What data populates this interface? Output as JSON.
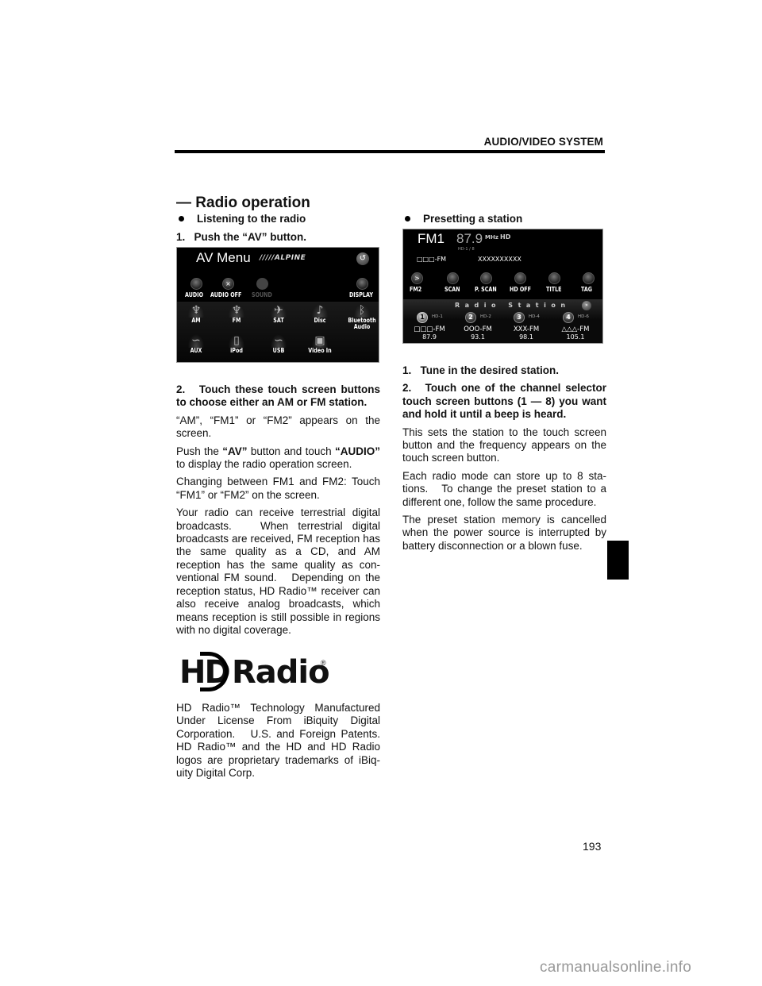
{
  "header": {
    "section": "AUDIO/VIDEO SYSTEM"
  },
  "section_title": "— Radio operation",
  "left_column": {
    "bullet": "Listening to the radio",
    "step1": "1.   Push the “AV” button.",
    "av_menu_screen": {
      "title": "AV Menu",
      "brand": "/////ALPINE",
      "back_icon": "back-arrow-icon",
      "top_buttons": [
        {
          "label": "AUDIO",
          "icon": "knob-icon",
          "enabled": true
        },
        {
          "label": "AUDIO OFF",
          "icon": "x-knob-icon",
          "enabled": true
        },
        {
          "label": "SOUND",
          "icon": "knob-icon",
          "enabled": false
        },
        {
          "label": "DISPLAY",
          "icon": "knob-icon",
          "enabled": true
        }
      ],
      "sources": [
        {
          "label": "AM",
          "icon": "antenna-icon",
          "glyph": "♆"
        },
        {
          "label": "FM",
          "icon": "antenna-icon",
          "glyph": "♆"
        },
        {
          "label": "SAT",
          "icon": "satellite-icon",
          "glyph": "✈"
        },
        {
          "label": "Disc",
          "icon": "disc-icon",
          "glyph": "♪"
        },
        {
          "label": "Bluetooth Audio",
          "icon": "bluetooth-icon",
          "glyph": "ᛒ"
        },
        {
          "label": "AUX",
          "icon": "cable-icon",
          "glyph": "∽"
        },
        {
          "label": "iPod",
          "icon": "ipod-icon",
          "glyph": "▯"
        },
        {
          "label": "USB",
          "icon": "usb-cable-icon",
          "glyph": "∽"
        },
        {
          "label": "Video In",
          "icon": "video-in-icon",
          "glyph": "▣"
        }
      ]
    },
    "step2": "2.   Touch these touch screen buttons to choose either an AM or FM station.",
    "p1": "“AM”, “FM1” or “FM2” appears on the screen.",
    "p2_pre": "Push the ",
    "p2_b1": "“AV”",
    "p2_mid": " button and touch ",
    "p2_b2": "“AUDIO”",
    "p2_post": " to display the radio operation screen.",
    "p3": "Changing between FM1 and FM2: Touch “FM1” or “FM2” on the screen.",
    "p4": "Your radio can receive terrestrial digital broadcasts.   When terrestrial digital broadcasts are received, FM reception has the same quality as a CD, and AM reception has the same quality as con-ventional FM sound.   Depending on the reception status, HD Radio™ receiver can also receive analog broadcasts, which means reception is still possible in regions with no digital coverage.",
    "logo": {
      "hd": "HD",
      "radio": "Radio",
      "reg": "®"
    },
    "p5": "HD Radio™ Technology Manufactured Under License From iBiquity Digital Corporation.   U.S. and Foreign Patents. HD Radio™ and the HD and HD Radio logos are proprietary trademarks of iBiq-uity Digital Corp."
  },
  "right_column": {
    "bullet": "Presetting a station",
    "radio_screen": {
      "band": "FM1",
      "frequency": "87.9",
      "unit": "MHz",
      "hd_badge": "HD",
      "hd_channel": "HD-1 / 8",
      "station_name": "□□□-FM",
      "station_text": "XXXXXXXXXX",
      "function_buttons": [
        {
          "label": "FM2",
          "icon": "arrow-knob-icon",
          "glyph": ">"
        },
        {
          "label": "SCAN",
          "icon": "knob-icon",
          "glyph": ""
        },
        {
          "label": "P. SCAN",
          "icon": "knob-icon",
          "glyph": ""
        },
        {
          "label": "HD OFF",
          "icon": "knob-icon",
          "glyph": ""
        },
        {
          "label": "TITLE",
          "icon": "knob-icon",
          "glyph": ""
        },
        {
          "label": "TAG",
          "icon": "knob-icon",
          "glyph": ""
        }
      ],
      "preset_band_title": "Radio Station",
      "preset_band_button_icon": "next-page-icon",
      "presets": [
        {
          "number": "1",
          "hd": "HD-1",
          "name": "□□□-FM",
          "frequency": "87.9",
          "selected": true
        },
        {
          "number": "2",
          "hd": "HD-2",
          "name": "OOO-FM",
          "frequency": "93.1",
          "selected": false
        },
        {
          "number": "3",
          "hd": "HD-4",
          "name": "XXX-FM",
          "frequency": "98.1",
          "selected": false
        },
        {
          "number": "4",
          "hd": "HD-6",
          "name": "△△△-FM",
          "frequency": "105.1",
          "selected": false
        }
      ]
    },
    "step1": "1.   Tune in the desired station.",
    "step2": "2.   Touch one of the channel selector touch screen buttons (1 — 8) you want and hold it until a beep is heard.",
    "p1": "This sets the station to the touch screen button and the frequency appears on the touch screen button.",
    "p2": "Each radio mode can store up to 8 sta-tions.   To change the preset station to a different one, follow the same procedure.",
    "p3": "The preset station memory is cancelled when the power source is interrupted by battery disconnection or a blown fuse."
  },
  "footer": {
    "page_number": "193",
    "watermark": "carmanualsonline.info"
  }
}
